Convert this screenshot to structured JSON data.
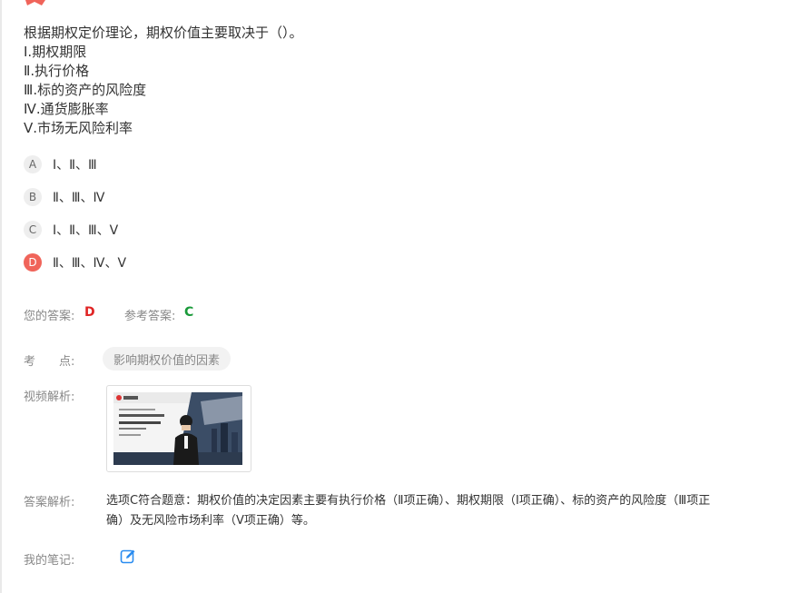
{
  "question": {
    "stem": "根据期权定价理论，期权价值主要取决于（）。",
    "items": [
      "Ⅰ.期权期限",
      "Ⅱ.执行价格",
      "Ⅲ.标的资产的风险度",
      "Ⅳ.通货膨胀率",
      "Ⅴ.市场无风险利率"
    ]
  },
  "options": [
    {
      "letter": "A",
      "text": "Ⅰ、Ⅱ、Ⅲ"
    },
    {
      "letter": "B",
      "text": "Ⅱ、Ⅲ、Ⅳ"
    },
    {
      "letter": "C",
      "text": "Ⅰ、Ⅱ、Ⅲ、Ⅴ"
    },
    {
      "letter": "D",
      "text": "Ⅱ、Ⅲ、Ⅳ、Ⅴ"
    }
  ],
  "answers": {
    "your_label": "您的答案:",
    "your_value": "D",
    "ref_label": "参考答案:",
    "ref_value": "C"
  },
  "knowledge": {
    "label": "考　　点:",
    "tag": "影响期权价值的因素"
  },
  "video": {
    "label": "视频解析:"
  },
  "explanation": {
    "label": "答案解析:",
    "text": "选项C符合题意：期权价值的决定因素主要有执行价格（Ⅱ项正确）、期权期限（Ⅰ项正确）、标的资产的风险度（Ⅲ项正确）及无风险市场利率（Ⅴ项正确）等。"
  },
  "notes": {
    "label": "我的笔记:",
    "icon": "edit-icon"
  },
  "colors": {
    "wrong": "#f0645a",
    "user_answer": "#e02424",
    "ref_answer": "#1a9a3a",
    "accent": "#2a8cf0"
  }
}
